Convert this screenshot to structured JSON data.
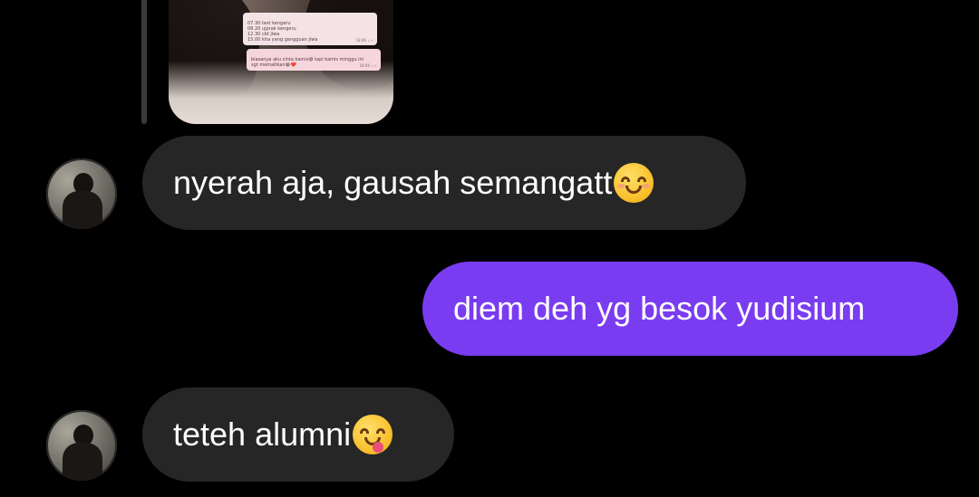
{
  "shared_image": {
    "note_lines": "07.30 test kengeru\n08.20 ujprak kengeru\n12.30 cbt jiwa\n15.00 kita yang gangguan jiwa",
    "note_time": "18:06 ✓✓",
    "note2_lines": "biasanya aku cinta kamis😅 tapi kamis minggu ini\nsgt mematikan😭❤️",
    "note2_time": "18:06 ✓✓"
  },
  "messages": [
    {
      "sender": "other",
      "text": "nyerah aja, gausah semangatt",
      "emoji": "smiling-face-icon"
    },
    {
      "sender": "me",
      "text": "diem deh yg besok yudisium"
    },
    {
      "sender": "other",
      "text": "teteh alumni",
      "emoji": "face-savoring-food-icon"
    }
  ],
  "colors": {
    "incoming_bubble": "#262626",
    "outgoing_bubble": "#7a3cf0",
    "background": "#000000"
  }
}
